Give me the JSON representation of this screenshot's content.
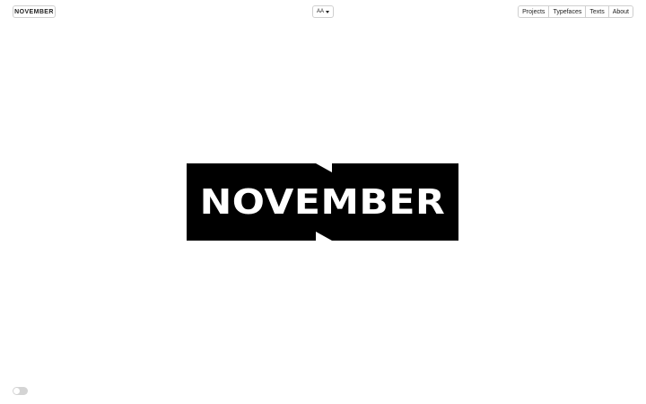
{
  "header": {
    "logo_label": "NOVEMBER",
    "font_toggle": {
      "label": "AA",
      "icon": "caret-down-icon"
    },
    "nav": [
      {
        "label": "Projects"
      },
      {
        "label": "Typefaces"
      },
      {
        "label": "Texts"
      },
      {
        "label": "About"
      }
    ]
  },
  "hero": {
    "wordmark": "NOVEMBER",
    "colors": {
      "background": "#000000",
      "text": "#ffffff"
    }
  },
  "footer": {
    "theme_toggle": {
      "state": "off",
      "icon": "toggle-switch-icon"
    }
  }
}
